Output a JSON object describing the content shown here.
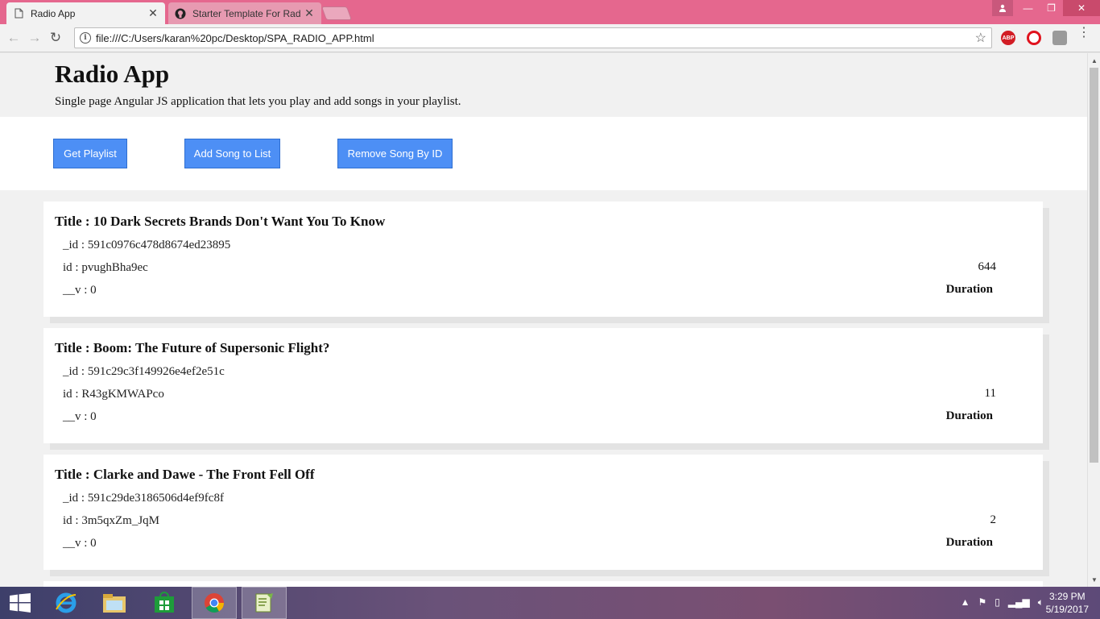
{
  "browser": {
    "tabs": [
      {
        "label": "Radio App",
        "icon": "page-icon",
        "active": true
      },
      {
        "label": "Starter Template For Rad",
        "icon": "github-icon",
        "active": false
      }
    ],
    "url": "file:///C:/Users/karan%20pc/Desktop/SPA_RADIO_APP.html"
  },
  "header": {
    "title": "Radio App",
    "subtitle": "Single page Angular JS application that lets you play and add songs in your playlist."
  },
  "actions": {
    "get_playlist": "Get Playlist",
    "add_song": "Add Song to List",
    "remove_song": "Remove Song By ID"
  },
  "songs": [
    {
      "title": "Title : 10 Dark Secrets Brands Don't Want You To Know",
      "_id": "_id : 591c0976c478d8674ed23895",
      "id": "id : pvughBha9ec",
      "v": "__v : 0",
      "duration": "644",
      "duration_label": "Duration"
    },
    {
      "title": "Title : Boom: The Future of Supersonic Flight?",
      "_id": "_id : 591c29c3f149926e4ef2e51c",
      "id": "id : R43gKMWAPco",
      "v": "__v : 0",
      "duration": "11",
      "duration_label": "Duration"
    },
    {
      "title": "Title : Clarke and Dawe - The Front Fell Off",
      "_id": "_id : 591c29de3186506d4ef9fc8f",
      "id": "id : 3m5qxZm_JqM",
      "v": "__v : 0",
      "duration": "2",
      "duration_label": "Duration"
    }
  ],
  "taskbar": {
    "time": "3:29 PM",
    "date": "5/19/2017"
  },
  "colors": {
    "titlebar": "#e5678e",
    "button": "#4d8ff5"
  }
}
